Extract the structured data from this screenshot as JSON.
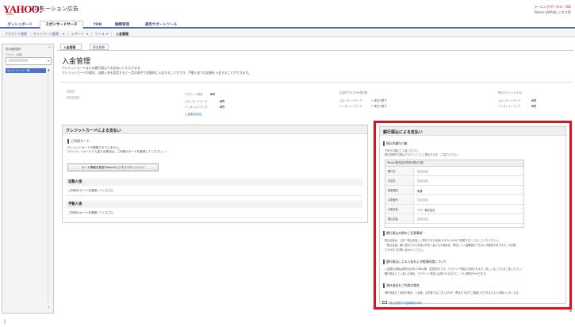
{
  "header": {
    "logo": "YAHOO!",
    "logo_sub": "JAPAN",
    "product": "プロモーション広告",
    "user_line1": "ラーニングポータル・Yah",
    "user_line2": "Yahoo! JAPANビジネスID"
  },
  "main_nav": [
    "ダッシュボード",
    "スポンサードサーチ",
    "YDN",
    "輸類管理",
    "運用サポートツール"
  ],
  "sub_nav": {
    "account": "アカウント管理",
    "campaign": "キャンペーン管理",
    "report": "レポート",
    "tool": "ツール",
    "deposit": "入金管理"
  },
  "left_panel": {
    "title": "表示期間選択",
    "account_label": "アカウント選択",
    "campaign_list": "キャンペーン一覧",
    "collapse": "«"
  },
  "content_tabs": [
    "入金管理",
    "資金移動"
  ],
  "page": {
    "title": "入金管理",
    "desc1": "クレジットカードまたは銀行振込でお支払いいただけます。",
    "desc2": "クレジットカードの場合、自動入金を設定すると一定の条件で自動的に入金することができ、手動入金では金額を入金することができます。"
  },
  "summary": {
    "account_balance_label": "アカウント残高",
    "account_balance": "0円",
    "sponsored_search_label": "スポンサードサーチ",
    "sponsored_search_value": "0円",
    "interest_match_label": "インタレストマッチ",
    "interest_match_value": "0円",
    "deposit_settings_link": "入金割合設定",
    "forecast_label": "広告終了までの予想日数",
    "forecast_ss": "スポンサードサーチ",
    "forecast_ss_value": "① 本日で終了",
    "forecast_im": "インタレストマッチ",
    "forecast_im_value": "① 本日で終了",
    "daily_label": "昨日のクリック(1日)",
    "daily_ss": "スポンサードサーチ",
    "daily_ss_value": "0円",
    "daily_im": "インタレストマッチ",
    "daily_im_value": "0円"
  },
  "credit_card": {
    "title": "クレジットカードによる支払い",
    "used_card": "ご利用カード",
    "msg1": "クレジットカードが登録されていません。",
    "msg2": "(クレジットカードで入金する場合は、ご利用のカードを登録してください。)",
    "register_button": "カード情報を登録(Yahoo!ビジネスマネージャー)",
    "auto_title": "自動入金",
    "auto_msg": "ご利用のカードを登録してください",
    "manual_title": "手動入金",
    "manual_msg": "ご利用のカードを登録してください"
  },
  "bank": {
    "title": "銀行振込による支払い",
    "section1": "振込先銀行口座",
    "section1_txt1": "下記の口座にご入金ください。",
    "section1_txt2": "振込先銀行口座はアカウントごとに異なります。ご注意ください。",
    "table_head": "Yahoo!株式会社専用の振込口座",
    "rows": [
      {
        "label": "銀行名",
        "value": ""
      },
      {
        "label": "支店名",
        "value": ""
      },
      {
        "label": "預金種目",
        "value": "普通"
      },
      {
        "label": "口座番号",
        "value": ""
      },
      {
        "label": "口座名義",
        "value": "ヤフー株式会社"
      },
      {
        "label": "振込名義",
        "value": ""
      }
    ],
    "section2": "銀行振込の際のご注意事項",
    "section2_txt1": "振込名義は、上記「振込名義」に表示された名義(カタカナ)のみで変更することなくご入力ください。",
    "section2_txt2": "「振込名義」欄に表示された名義以外を入金された場合は、弊社にて入金確認をできない可能性があります。お手数",
    "section2_txt3": "ですがまでお問い合わせください。",
    "section3": "銀行振込による入金および経過処理について",
    "section3_txt1": "入金額の反映は原則当日中(15時以降、翌営業日)です。アカウント残高に反映されます。詳しくはこちらをご覧ください。",
    "section3_txt2": "銀行振込にて入金した場合、アカウント残高に反映されるまでに、少し時間がかかります。",
    "section4": "海外送金をご利用の場合",
    "section4_txt1": "海外送金をご利用の場合、入金後、お手数ではございますが、弊社まで必ずご連絡いただきますようお願いいたします。",
    "print_link": "振込先銀行口座情報を印刷"
  },
  "misc": {
    "resize_glyph": "◢",
    "cursor": "|"
  }
}
